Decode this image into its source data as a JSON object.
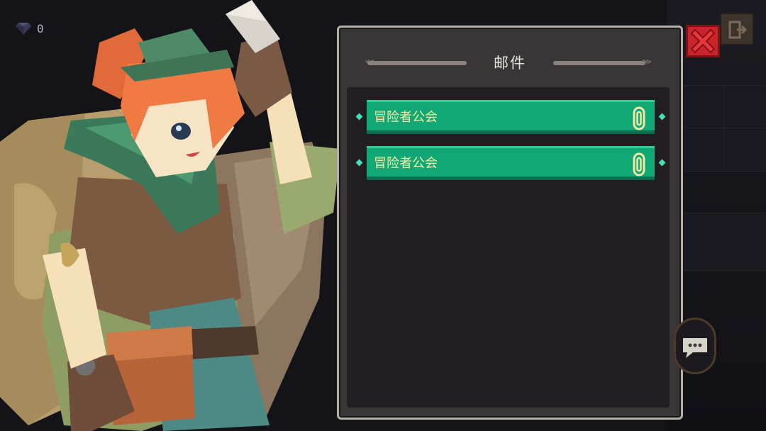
{
  "currency": {
    "gems": "0",
    "icon": "gem-icon"
  },
  "mail_panel": {
    "title": "邮件",
    "items": [
      {
        "sender": "冒险者公会",
        "attachment_icon": "paperclip-icon"
      },
      {
        "sender": "冒险者公会",
        "attachment_icon": "paperclip-icon"
      }
    ]
  },
  "controls": {
    "close_icon": "close-icon",
    "exit_icon": "exit-door-icon",
    "chat_icon": "chat-bubble-icon"
  },
  "colors": {
    "mail_item": "#12a876",
    "close_button": "#c8242a",
    "panel_border": "#b6afa9",
    "sender_text": "#f2e9a2"
  }
}
